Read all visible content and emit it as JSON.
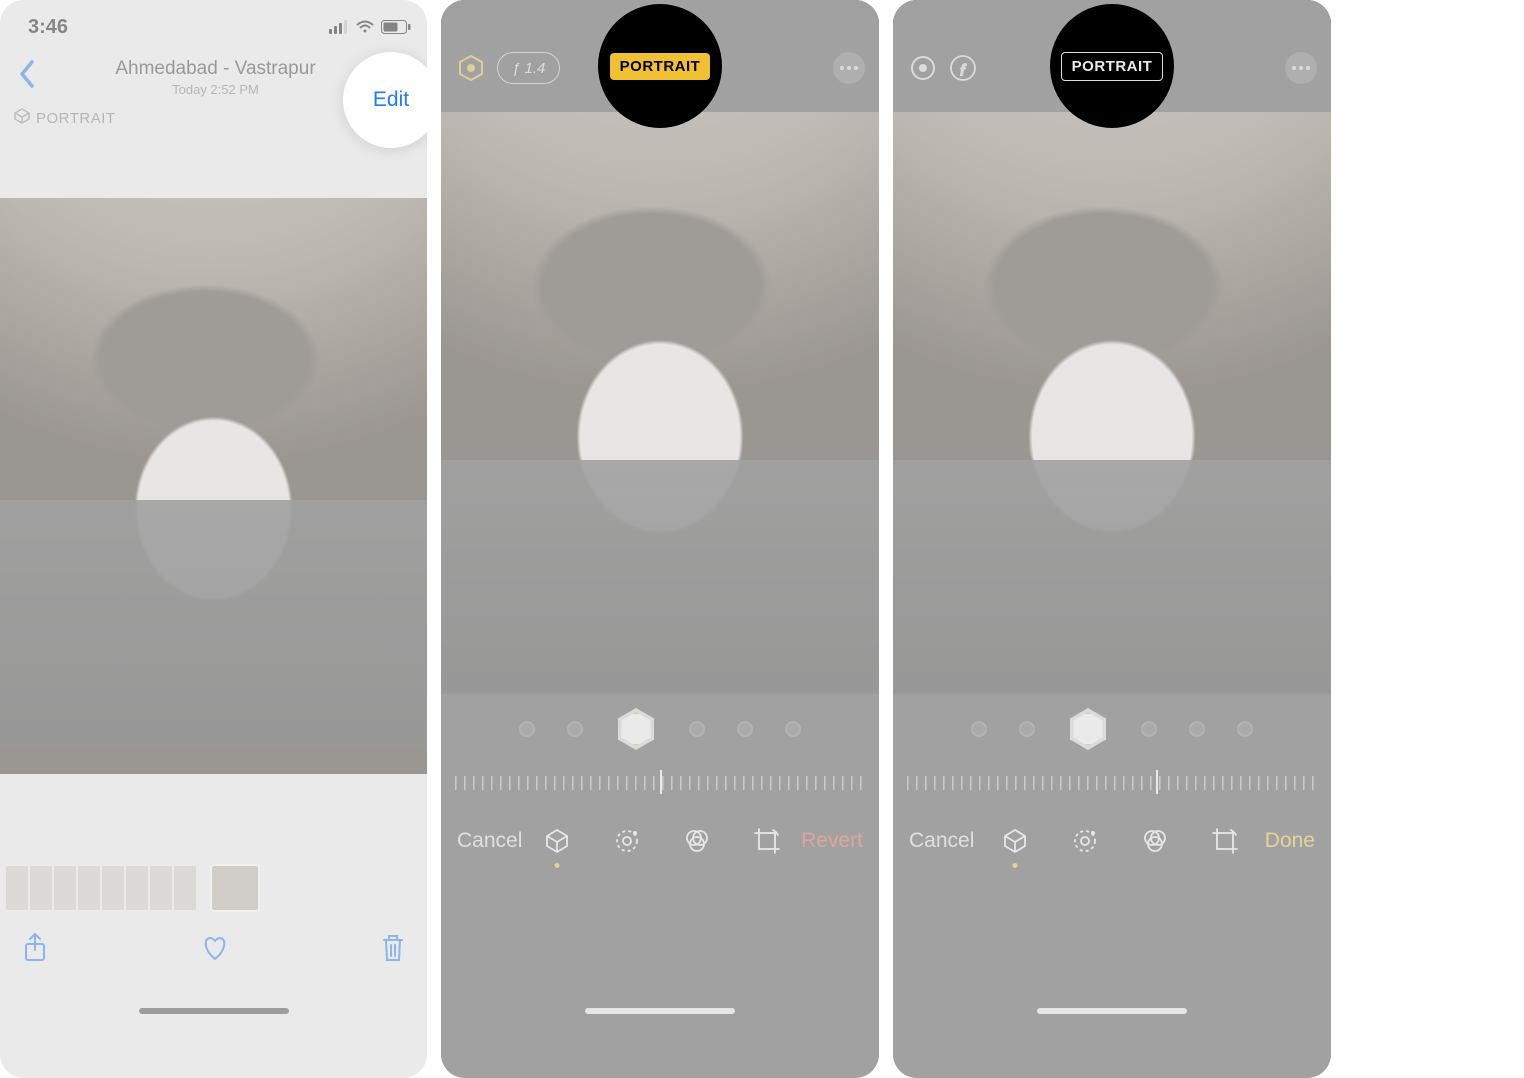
{
  "panel1": {
    "status": {
      "time": "3:46"
    },
    "nav": {
      "location": "Ahmedabad - Vastrapur",
      "subtitle": "Today 2:52 PM",
      "edit": "Edit"
    },
    "portrait_tag": "PORTRAIT"
  },
  "panel2": {
    "fstop": "ƒ 1.4",
    "portrait_badge": "PORTRAIT",
    "cancel": "Cancel",
    "action": "Revert"
  },
  "panel3": {
    "portrait_badge": "PORTRAIT",
    "cancel": "Cancel",
    "action": "Done"
  }
}
